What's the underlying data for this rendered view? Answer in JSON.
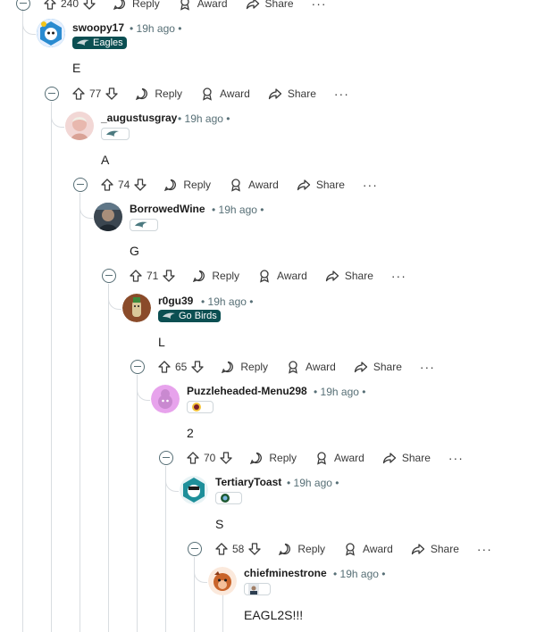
{
  "top_action": {
    "votes": "240",
    "reply": "Reply",
    "award": "Award",
    "share": "Share",
    "more": "···"
  },
  "comments": [
    {
      "username": "swoopy17",
      "time": "19h ago",
      "flair": "Eagles",
      "body": "E",
      "votes": "77",
      "reply": "Reply",
      "award": "Award",
      "share": "Share",
      "more": "···"
    },
    {
      "username": "_augustusgray",
      "time": "19h ago",
      "flair": "",
      "body": "A",
      "votes": "74",
      "reply": "Reply",
      "award": "Award",
      "share": "Share",
      "more": "···"
    },
    {
      "username": "BorrowedWine",
      "time": "19h ago",
      "flair": "",
      "body": "G",
      "votes": "71",
      "reply": "Reply",
      "award": "Award",
      "share": "Share",
      "more": "···"
    },
    {
      "username": "r0gu39",
      "time": "19h ago",
      "flair": "Go Birds",
      "body": "L",
      "votes": "65",
      "reply": "Reply",
      "award": "Award",
      "share": "Share",
      "more": "···"
    },
    {
      "username": "Puzzleheaded-Menu298",
      "time": "19h ago",
      "flair": "",
      "body": "2",
      "votes": "70",
      "reply": "Reply",
      "award": "Award",
      "share": "Share",
      "more": "···"
    },
    {
      "username": "TertiaryToast",
      "time": "19h ago",
      "flair": "",
      "body": "S",
      "votes": "58",
      "reply": "Reply",
      "award": "Award",
      "share": "Share",
      "more": "···"
    },
    {
      "username": "chiefminestrone",
      "time": "19h ago",
      "flair": "",
      "body": "EAGL2S!!!"
    }
  ],
  "colors": {
    "flair_bg": "#0b4f52",
    "thread_line": "#d9dde1",
    "meta": "#576f76"
  }
}
